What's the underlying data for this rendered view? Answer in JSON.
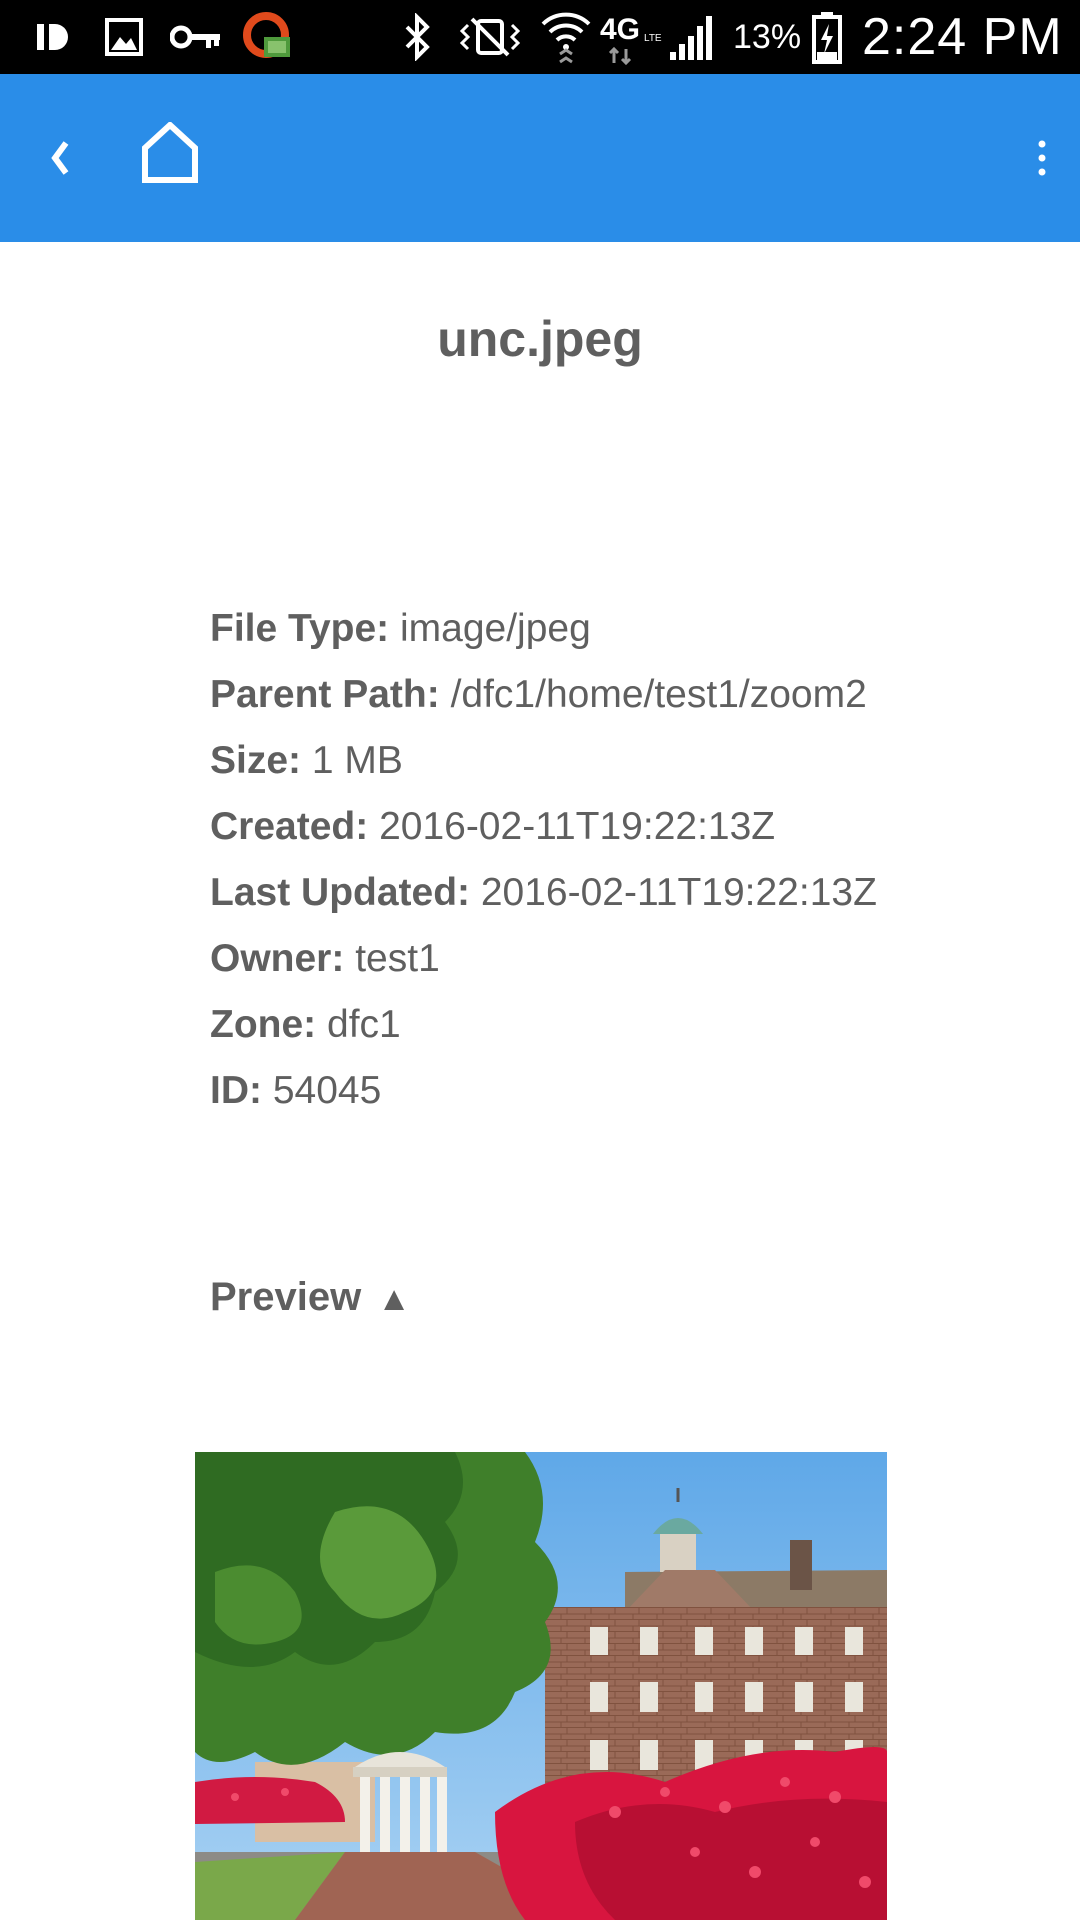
{
  "status_bar": {
    "icons": [
      "app-notification-icon",
      "gallery-notification-icon",
      "key-icon",
      "vpn-app-icon",
      "bluetooth-icon",
      "vibrate-mute-icon",
      "wifi-icon",
      "4g-lte-icon",
      "signal-icon",
      "battery-charging-icon"
    ],
    "battery_percent": "13%",
    "time": "2:24 PM"
  },
  "app_bar": {
    "color": "#2a8de8",
    "back_icon": "back-chevron-icon",
    "home_icon": "home-icon",
    "menu_icon": "overflow-menu-icon"
  },
  "file": {
    "title": "unc.jpeg"
  },
  "details": [
    {
      "label": "File Type:",
      "value": "image/jpeg"
    },
    {
      "label": "Parent Path:",
      "value": "/dfc1/home/test1/zoom2"
    },
    {
      "label": "Size:",
      "value": "1 MB"
    },
    {
      "label": "Created:",
      "value": "2016-02-11T19:22:13Z"
    },
    {
      "label": "Last Updated:",
      "value": "2016-02-11T19:22:13Z"
    },
    {
      "label": "Owner:",
      "value": "test1"
    },
    {
      "label": "Zone:",
      "value": "dfc1"
    },
    {
      "label": "ID:",
      "value": "54045"
    }
  ],
  "preview": {
    "label": "Preview",
    "arrow": "▲"
  }
}
